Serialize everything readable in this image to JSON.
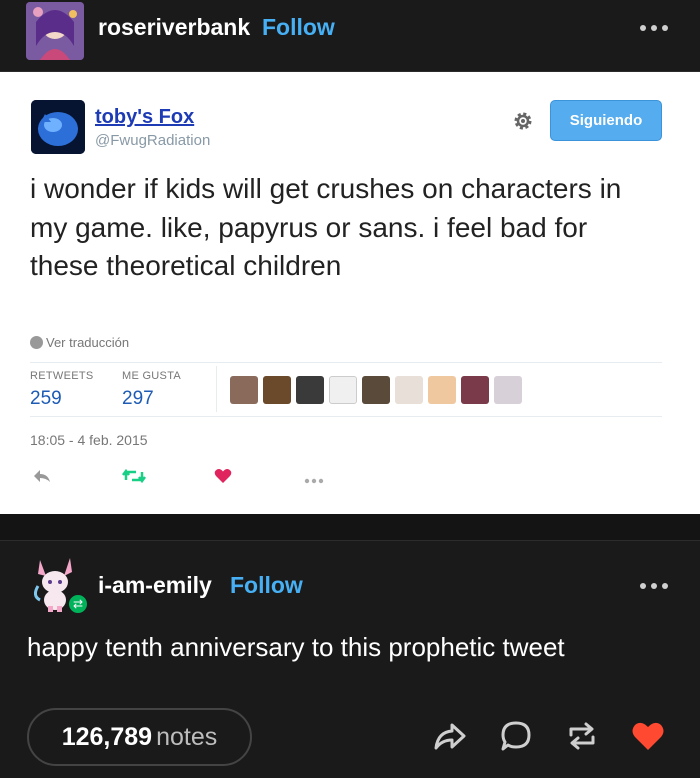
{
  "post": {
    "username": "roseriverbank",
    "follow_label": "Follow"
  },
  "tweet": {
    "display_name": "toby's Fox",
    "handle": "@FwugRadiation",
    "follow_button": "Siguiendo",
    "text": "i wonder if kids will get crushes on characters in my game. like, papyrus or sans. i feel bad for these theoretical children",
    "translate_label": "Ver traducción",
    "retweets_label": "RETWEETS",
    "retweets_count": "259",
    "likes_label": "ME GUSTA",
    "likes_count": "297",
    "timestamp": "18:05 - 4 feb. 2015"
  },
  "reblog": {
    "username": "i-am-emily",
    "follow_label": "Follow",
    "text": "happy tenth anniversary to this prophetic tweet"
  },
  "footer": {
    "notes_count": "126,789",
    "notes_label": "notes"
  },
  "colors": {
    "follow_link": "#47b0f5",
    "tweet_follow_button": "#55acee",
    "like_heart": "#ff4930",
    "reblog_badge": "#00b35a"
  },
  "icons": [
    "more-icon",
    "gear-icon",
    "globe-icon",
    "reply-icon",
    "retweet-icon",
    "like-icon",
    "share-icon",
    "comment-icon",
    "reblog-icon",
    "heart-icon"
  ]
}
